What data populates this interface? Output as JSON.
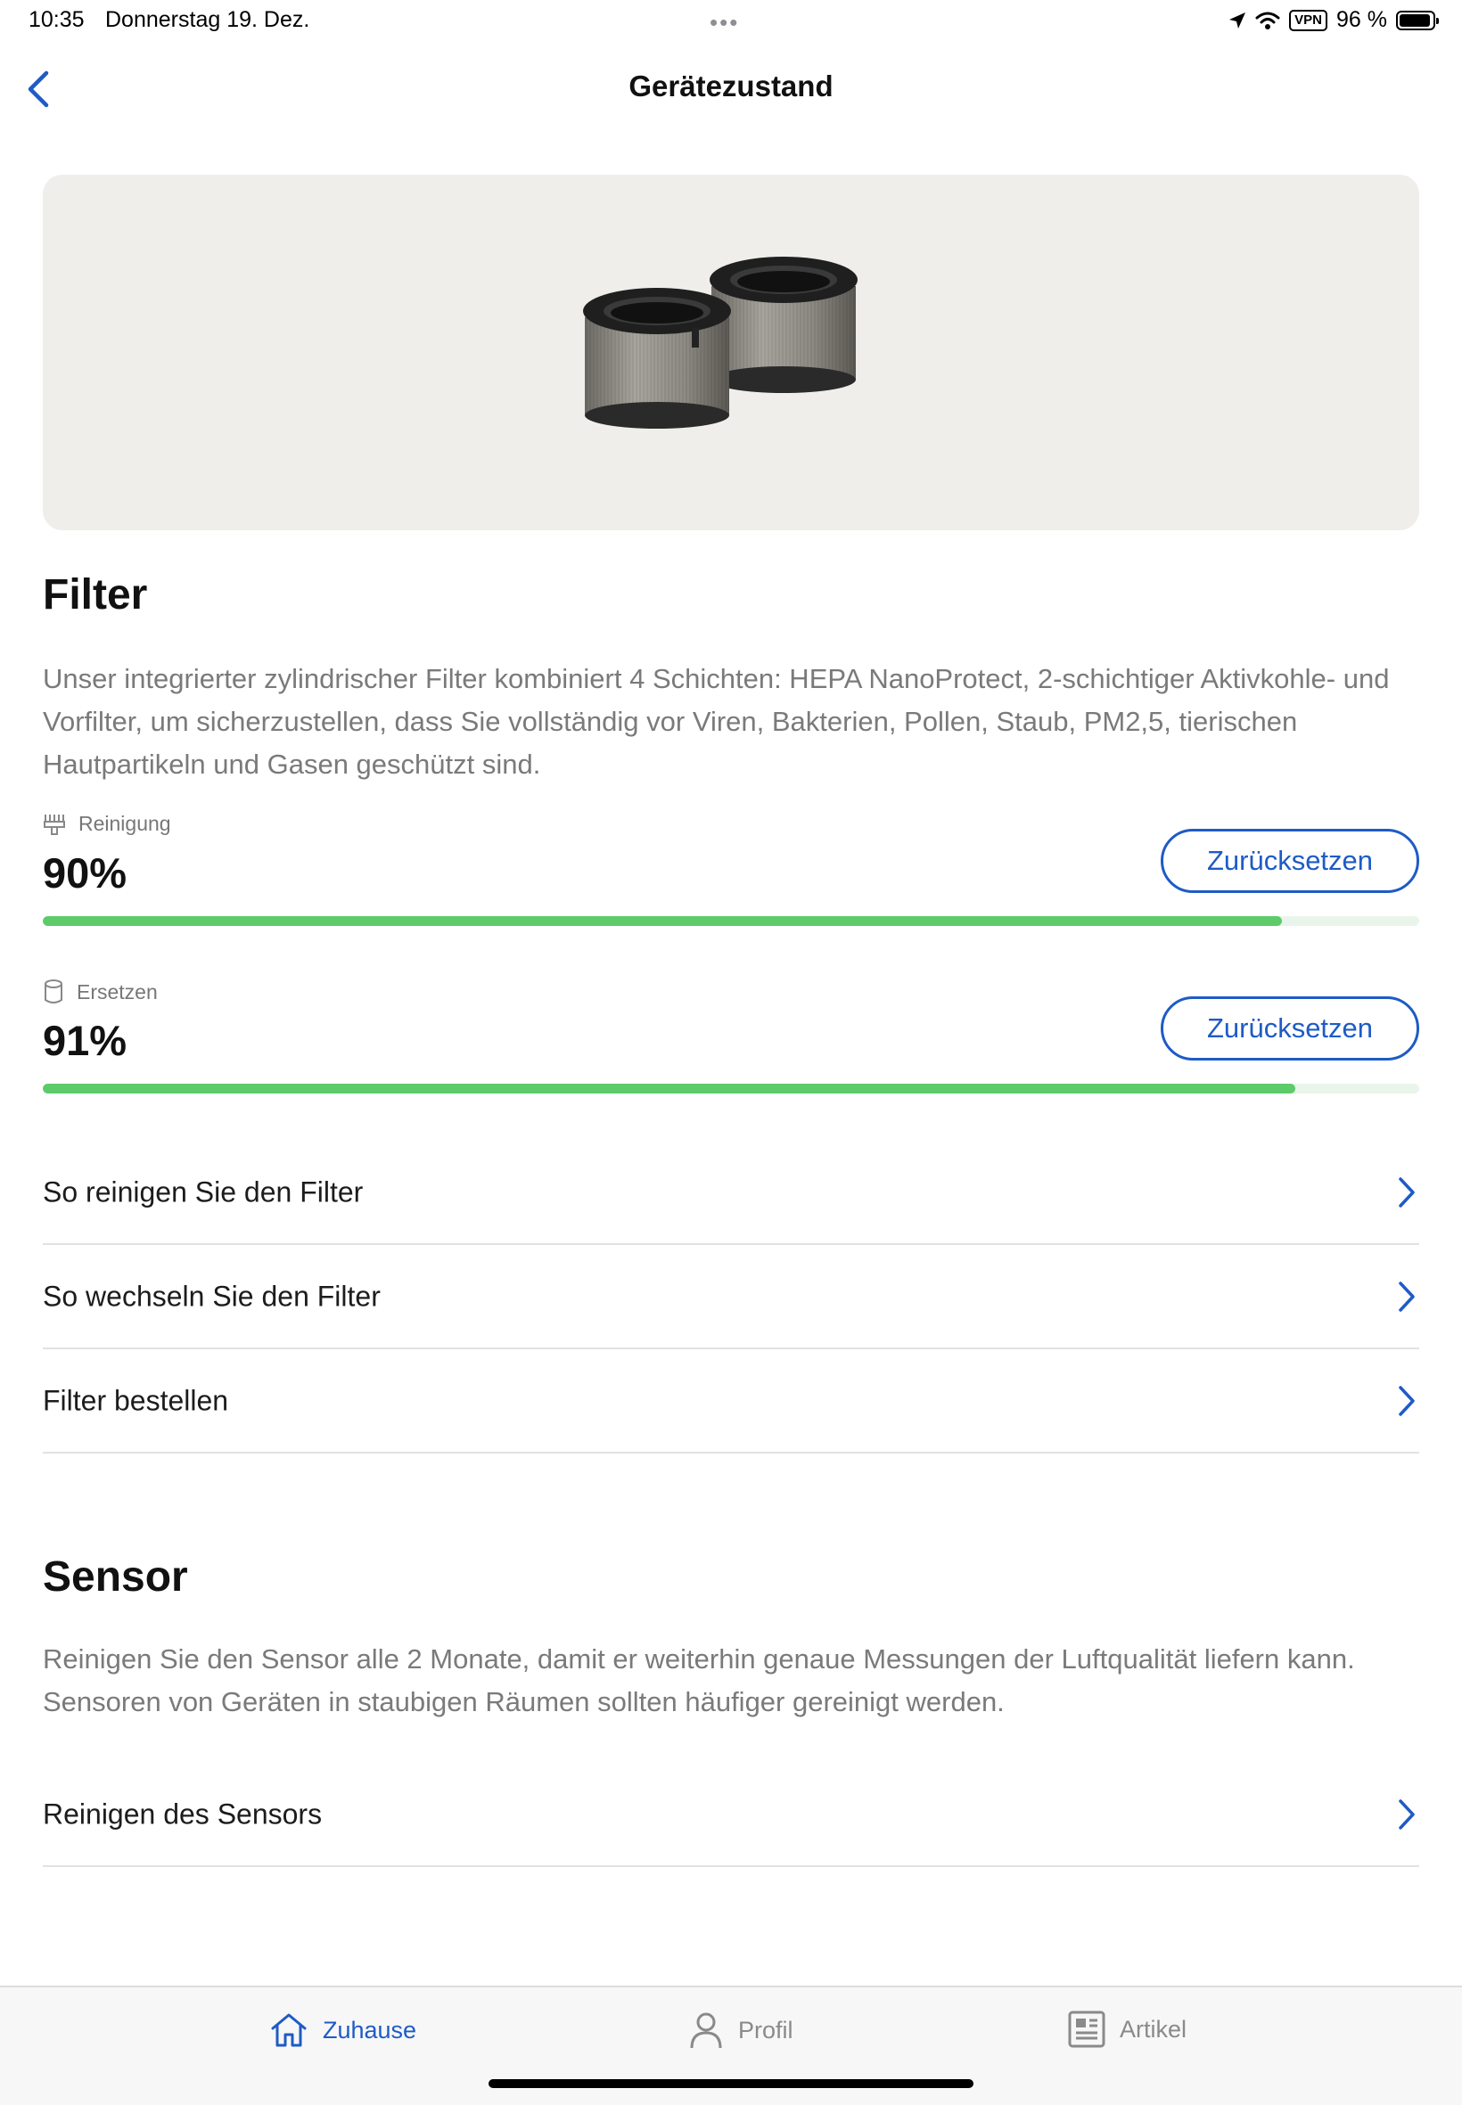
{
  "status_bar": {
    "time": "10:35",
    "date": "Donnerstag 19. Dez.",
    "vpn": "VPN",
    "battery": "96 %",
    "battery_level": 0.96
  },
  "nav": {
    "title": "Gerätezustand"
  },
  "filter": {
    "title": "Filter",
    "description": "Unser integrierter zylindrischer Filter kombiniert 4 Schichten: HEPA NanoProtect, 2-schichtiger Aktivkohle- und Vorfilter, um sicherzustellen, dass Sie vollständig vor Viren, Bakterien, Pollen, Staub, PM2,5, tierischen Hautpartikeln und Gasen geschützt sind.",
    "metrics": [
      {
        "icon": "brush-icon",
        "label": "Reinigung",
        "value": "90%",
        "level": 0.9,
        "button": "Zurücksetzen"
      },
      {
        "icon": "cylinder-icon",
        "label": "Ersetzen",
        "value": "91%",
        "level": 0.91,
        "button": "Zurücksetzen"
      }
    ],
    "links": [
      {
        "label": "So reinigen Sie den Filter"
      },
      {
        "label": "So wechseln Sie den Filter"
      },
      {
        "label": "Filter bestellen"
      }
    ]
  },
  "sensor": {
    "title": "Sensor",
    "description": "Reinigen Sie den Sensor alle 2 Monate, damit er weiterhin genaue Messungen der Luftqualität liefern kann. Sensoren von Geräten in staubigen Räumen sollten häufiger gereinigt werden.",
    "links": [
      {
        "label": "Reinigen des Sensors"
      }
    ]
  },
  "tab_bar": {
    "tabs": [
      {
        "label": "Zuhause",
        "icon": "home-icon",
        "active": true
      },
      {
        "label": "Profil",
        "icon": "person-icon",
        "active": false
      },
      {
        "label": "Artikel",
        "icon": "article-icon",
        "active": false
      }
    ]
  },
  "colors": {
    "accent": "#1e5bc6",
    "progress": "#5dcb6a",
    "progress_track": "#e9f5ea",
    "hero_background": "#efeeea"
  }
}
